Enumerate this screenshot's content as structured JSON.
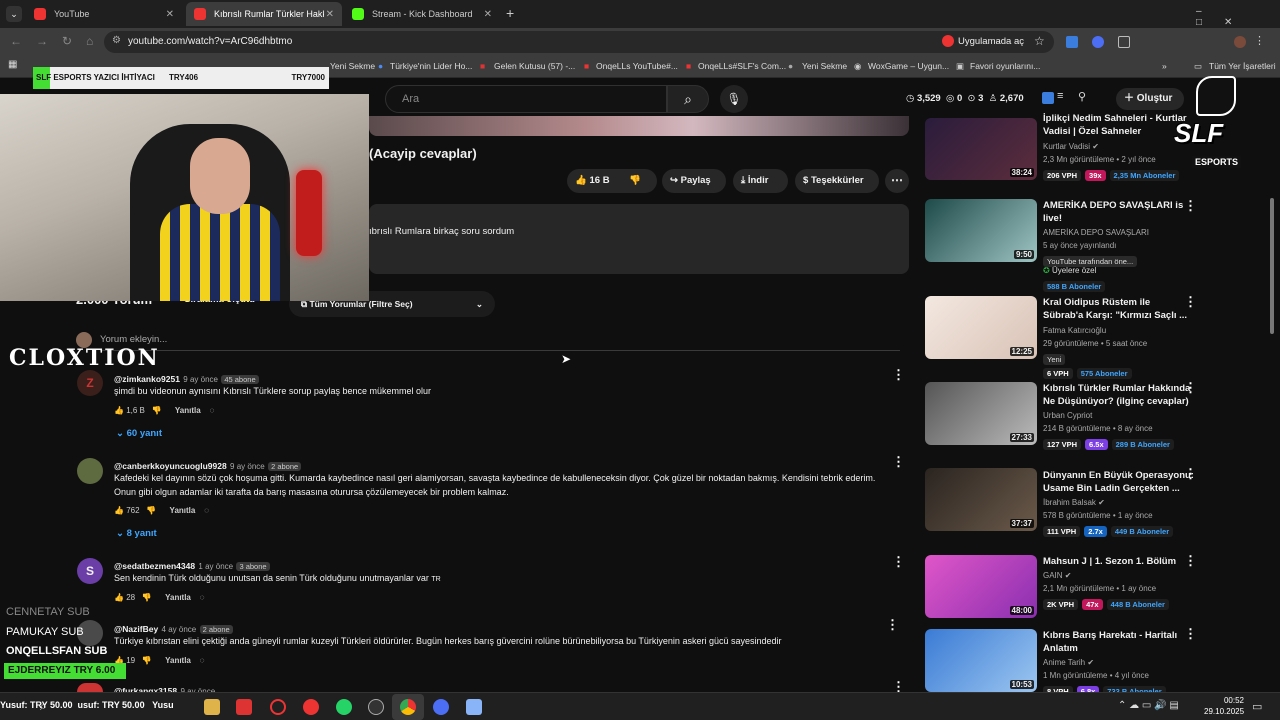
{
  "tabs": [
    {
      "label": "YouTube"
    },
    {
      "label": "Kıbrıslı Rumlar Türkler Hakkında"
    },
    {
      "label": "Stream - Kick Dashboard"
    }
  ],
  "address": {
    "url": "youtube.com/watch?v=ArC96dhbtmo",
    "open_in_app": "Uygulamada aç"
  },
  "bookmarks": {
    "items": [
      "Yeni Sekme",
      "Türkiye'nin Lider Ho...",
      "Gelen Kutusu (57) -...",
      "OnqeLLs YouTube#...",
      "OnqeLLs#SLF's Com...",
      "Yeni Sekme",
      "WoxGame – Uygun...",
      "Favori oyunlarını..."
    ],
    "all": "Tüm Yer İşaretleri"
  },
  "overlay": {
    "poll": "SLF ESPORTS YAZICI İHTİYACI",
    "left_amt": "TRY406",
    "right_amt": "TRY7000",
    "brand": "CLOXTION",
    "subs": [
      "CENNETAY SUB",
      "PAMUKAY SUB",
      "ONQELLSFAN SUB"
    ],
    "donation": "EJDERREYIZ TRY 6.00",
    "team": "SLF",
    "team_sub": "ESPORTS"
  },
  "header": {
    "search_placeholder": "Ara",
    "stats": [
      "3,529",
      "0",
      "3",
      "2,670"
    ],
    "create": "Oluştur"
  },
  "video": {
    "title_tail": "(Acayip cevaplar)",
    "likes": "16 B",
    "share": "Paylaş",
    "download": "İndir",
    "thanks": "Teşekkürler",
    "desc": "ıbrıslı Rumlara birkaç soru sordum"
  },
  "comments": {
    "count": "2.000 Yorum",
    "sort": "Sıralama ölçütü",
    "filter": "Tüm Yorumlar (Filtre Seç)",
    "add": "Yorum ekleyin...",
    "reply": "Yanıtla",
    "items": [
      {
        "author": "@zimkanko9251",
        "time": "9 ay önce",
        "badge": "45 abone",
        "text": "şimdi bu videonun aynısını Kıbrıslı Türklere sorup paylaş bence mükemmel olur",
        "likes": "1,6 B",
        "replies": "60 yanıt"
      },
      {
        "author": "@canberkkoyuncuoglu9928",
        "time": "9 ay önce",
        "badge": "2 abone",
        "text": "Kafedeki kel dayının sözü çok hoşuma gitti. Kumarda kaybedince nasıl geri alamiyorsan, savaşta kaybedince de kabulleneceksin diyor. Çok güzel bir noktadan bakmış. Kendisini tebrik ederim.",
        "text2": "Onun gibi olgun adamlar iki tarafta da barış masasına  oturursa çözülemeyecek bir problem kalmaz.",
        "likes": "762",
        "replies": "8 yanıt"
      },
      {
        "author": "@sedatbezmen4348",
        "time": "1 ay önce",
        "badge": "3 abone",
        "text": "Sen kendinin Türk olduğunu unutsan da senin Türk olduğunu unutmayanlar var",
        "likes": "28"
      },
      {
        "author": "@NazifBey",
        "time": "4 ay önce",
        "badge": "2 abone",
        "text": "Türkiye kıbrıstan elini çektiği anda güneyli rumlar kuzeyli Türkleri öldürürler. Bugün herkes barış güvercini rolüne bürünebiliyorsa bu Türkiyenin askeri gücü sayesindedir",
        "likes": "19"
      },
      {
        "author": "@furkanqx3158",
        "time": "9 ay önce"
      }
    ]
  },
  "related": [
    {
      "title": "İplikçi Nedim Sahneleri - Kurtlar",
      "title2": "Vadisi | Özel Sahneler",
      "channel": "Kurtlar Vadisi",
      "meta": "2,3 Mn görüntüleme • 2 yıl önce",
      "duration": "38:24",
      "vph": "206 VPH",
      "mult": "39x",
      "subs": "2,35 Mn Aboneler"
    },
    {
      "title": "AMERİKA DEPO SAVAŞLARI is",
      "title2": "live!",
      "channel": "AMERİKA DEPO SAVAŞLARI",
      "meta": "5 ay önce yayınlandı",
      "duration": "9:50",
      "tag1": "YouTube tarafından öne...",
      "tag2": "Üyelere özel",
      "subs": "588 B Aboneler"
    },
    {
      "title": "Kral Oidipus Rüstem ile",
      "title2": "Sübrab'a Karşı: \"Kırmızı Saçlı ...",
      "channel": "Fatma Katırcıoğlu",
      "meta": "29 görüntüleme • 5 saat önce",
      "duration": "12:25",
      "tag1": "Yeni",
      "vph": "6 VPH",
      "subs": "575 Aboneler"
    },
    {
      "title": "Kıbrıslı Türkler Rumlar Hakkında",
      "title2": "Ne Düşünüyor? (ilginç cevaplar)",
      "channel": "Urban Cypriot",
      "meta": "214 B görüntüleme • 8 ay önce",
      "duration": "27:33",
      "vph": "127 VPH",
      "mult": "6.5x",
      "subs": "289 B Aboneler"
    },
    {
      "title": "Dünyanın En Büyük Operasyonu:",
      "title2": "Usame Bin Ladin Gerçekten ...",
      "channel": "İbrahim Balsak",
      "meta": "578 B görüntüleme • 1 ay önce",
      "duration": "37:37",
      "vph": "111 VPH",
      "mult": "2.7x",
      "subs": "449 B Aboneler"
    },
    {
      "title": "Mahsun J | 1. Sezon 1. Bölüm",
      "title2": "",
      "channel": "GAIN",
      "meta": "2,1 Mn görüntüleme • 1 ay önce",
      "duration": "48:00",
      "vph": "2K VPH",
      "mult": "47x",
      "subs": "448 B Aboneler"
    },
    {
      "title": "Kıbrıs Barış Harekatı - Haritalı",
      "title2": "Anlatım",
      "channel": "Anime Tarih",
      "meta": "1 Mn görüntüleme • 4 yıl önce",
      "duration": "10:53",
      "vph": "8 VPH",
      "mult": "6.8x",
      "subs": "733 B Aboneler"
    }
  ],
  "taskbar": {
    "ticker1": "Yusuf: TRY 50.00",
    "ticker2": "usuf: TRY 50.00",
    "ticker3": "Yusu",
    "time": "00:52",
    "date": "29.10.2025"
  }
}
